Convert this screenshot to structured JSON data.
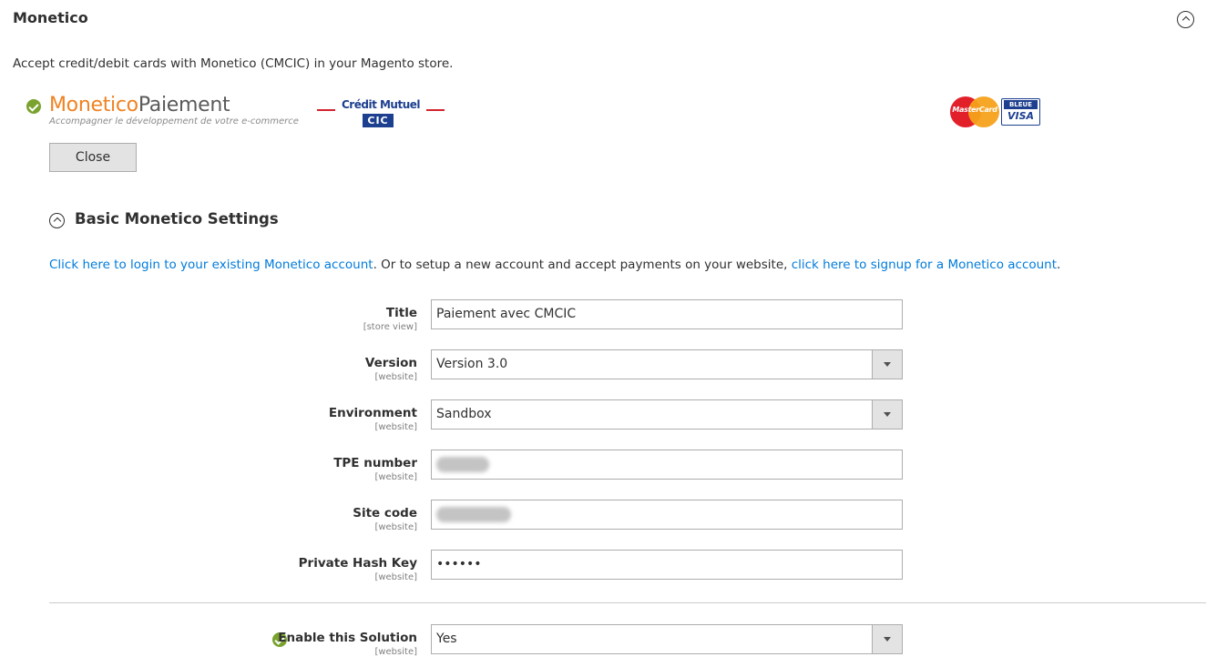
{
  "section": {
    "title": "Monetico"
  },
  "intro": "Accept credit/debit cards with Monetico (CMCIC) in your Magento store.",
  "logos": {
    "monetico_part1": "Monetico",
    "monetico_part2": "Paiement",
    "monetico_tagline": "Accompagner le développement de votre e-commerce",
    "credit_mutuel": "Crédit Mutuel",
    "cic": "CIC",
    "mastercard": "MasterCard",
    "visa_top": "BLEUE",
    "visa_bottom": "VISA"
  },
  "close_label": "Close",
  "basic": {
    "title": "Basic Monetico Settings",
    "login_link": "Click here to login to your existing Monetico account",
    "middle_text": ". Or to setup a new account and accept payments on your website, ",
    "signup_link": "click here to signup for a Monetico account",
    "end_text": "."
  },
  "fields": {
    "title": {
      "label": "Title",
      "scope": "[store view]",
      "value": "Paiement avec CMCIC"
    },
    "version": {
      "label": "Version",
      "scope": "[website]",
      "value": "Version 3.0"
    },
    "environment": {
      "label": "Environment",
      "scope": "[website]",
      "value": "Sandbox"
    },
    "tpe": {
      "label": "TPE number",
      "scope": "[website]",
      "value": ""
    },
    "site_code": {
      "label": "Site code",
      "scope": "[website]",
      "value": ""
    },
    "hash_key": {
      "label": "Private Hash Key",
      "scope": "[website]",
      "value": "••••••"
    },
    "enable": {
      "label": "Enable this Solution",
      "scope": "[website]",
      "value": "Yes"
    }
  },
  "colors": {
    "link": "#007bdb",
    "check": "#79a22e",
    "monetico_orange": "#f08221"
  }
}
